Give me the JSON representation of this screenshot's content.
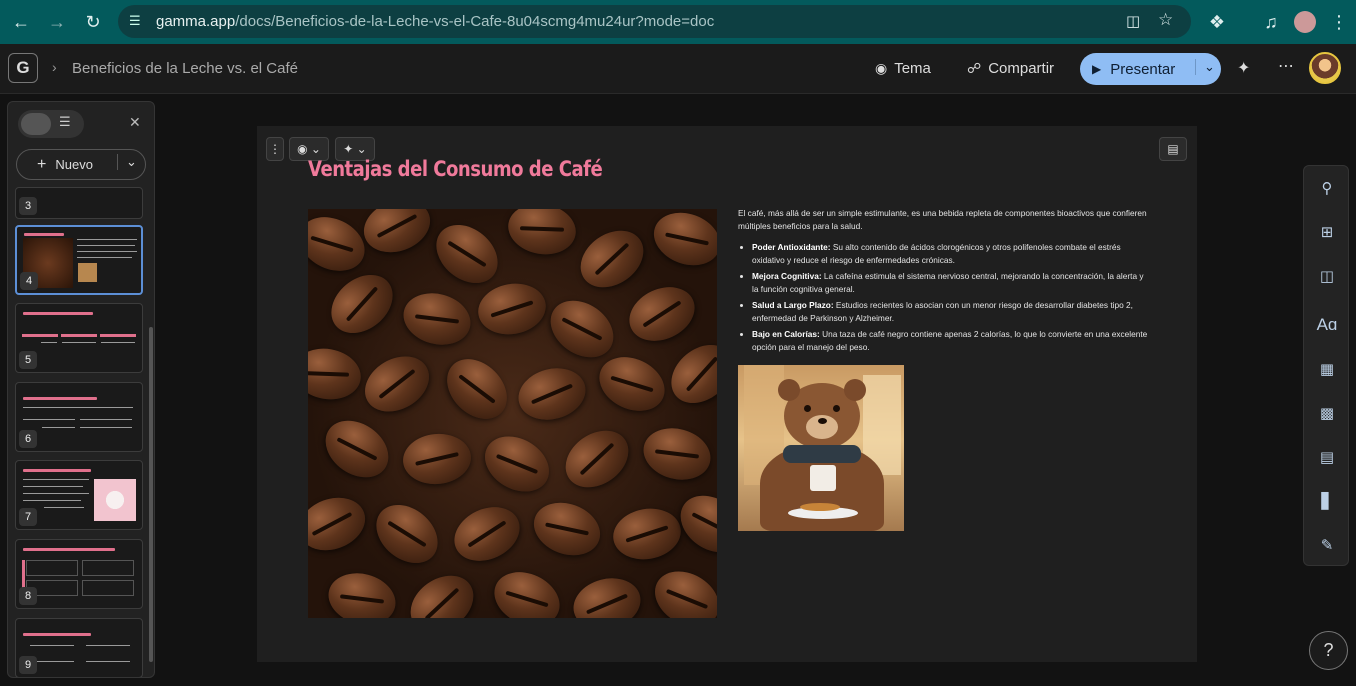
{
  "browser": {
    "url_domain": "gamma.app",
    "url_path": "/docs/Beneficios-de-la-Leche-vs-el-Cafe-8u04scmg4mu24ur?mode=doc"
  },
  "app": {
    "logo": "G",
    "doc_title": "Beneficios de la Leche vs. el Café",
    "tema_label": "Tema",
    "compartir_label": "Compartir",
    "presentar_label": "Presentar"
  },
  "panel": {
    "new_label": "Nuevo",
    "slides": [
      "3",
      "4",
      "5",
      "6",
      "7",
      "8",
      "9"
    ],
    "active_slide": "4"
  },
  "slide": {
    "title": "Ventajas del Consumo de Café",
    "intro": "El café, más allá de ser un simple estimulante, es una bebida repleta de componentes bioactivos que confieren múltiples beneficios para la salud.",
    "bullets": [
      {
        "title": "Poder Antioxidante:",
        "text": " Su alto contenido de ácidos clorogénicos y otros polifenoles combate el estrés oxidativo y reduce el riesgo de enfermedades crónicas."
      },
      {
        "title": "Mejora Cognitiva:",
        "text": " La cafeína estimula el sistema nervioso central, mejorando la concentración, la alerta y la función cognitiva general."
      },
      {
        "title": "Salud a Largo Plazo:",
        "text": " Estudios recientes lo asocian con un menor riesgo de desarrollar diabetes tipo 2, enfermedad de Parkinson y Alzheimer."
      },
      {
        "title": "Bajo en Calorías:",
        "text": " Una taza de café negro contiene apenas 2 calorías, lo que lo convierte en una excelente opción para el manejo del peso."
      }
    ]
  },
  "help": "?",
  "colors": {
    "accent_pink": "#f07a9b",
    "present_blue": "#8fbdf4",
    "browser_teal": "#035a5c"
  }
}
